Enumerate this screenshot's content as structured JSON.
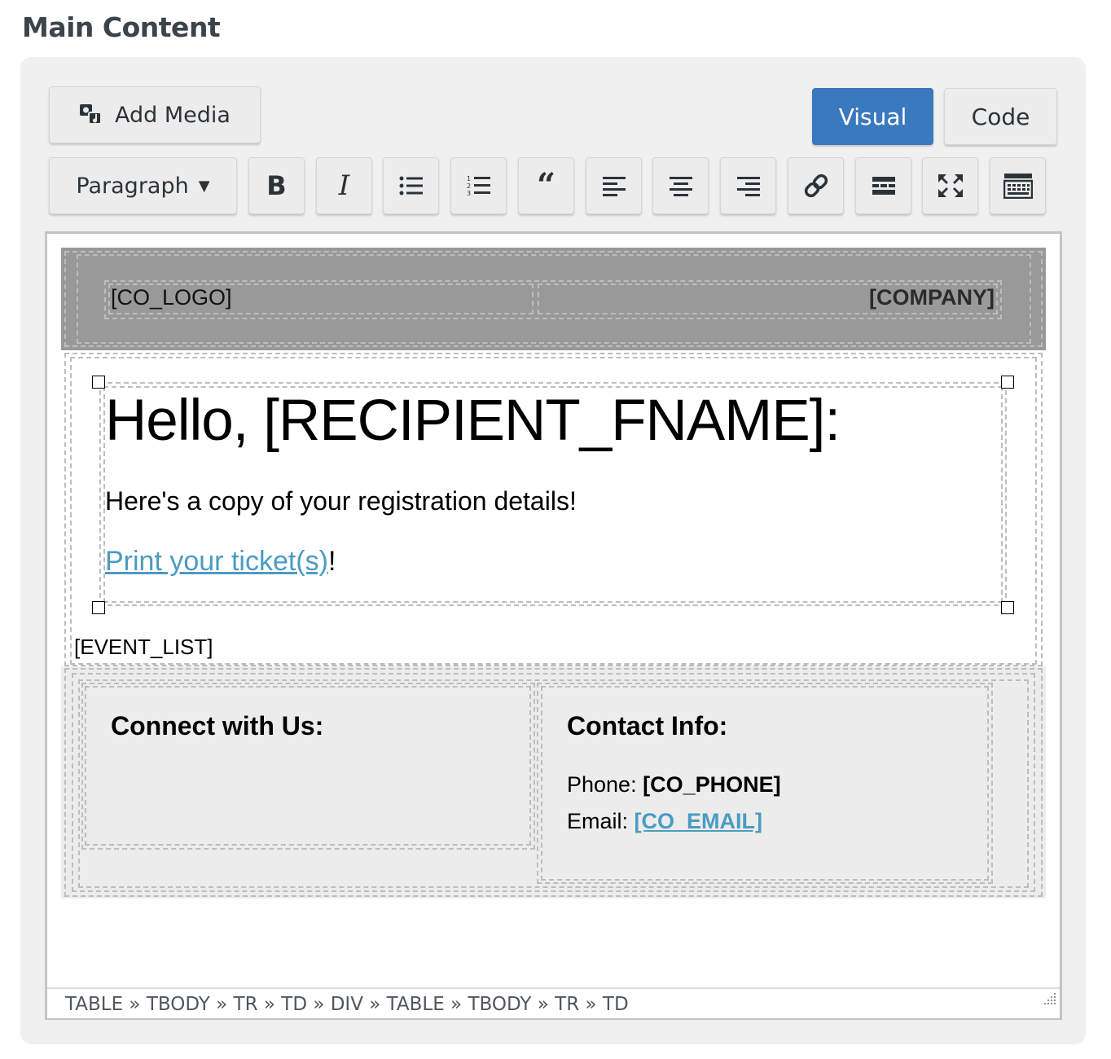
{
  "section_title": "Main Content",
  "toolbar": {
    "add_media_label": "Add Media",
    "visual_label": "Visual",
    "code_label": "Code",
    "format_select_value": "Paragraph",
    "bold_label": "B",
    "italic_label": "I",
    "buttons": [
      "bold-icon",
      "italic-icon",
      "bulleted-list-icon",
      "numbered-list-icon",
      "blockquote-icon",
      "align-left-icon",
      "align-center-icon",
      "align-right-icon",
      "link-icon",
      "read-more-icon",
      "fullscreen-icon",
      "toolbar-toggle-icon"
    ],
    "visual_color": "#3b79bf"
  },
  "content": {
    "co_logo": "[CO_LOGO]",
    "company": "[COMPANY]",
    "greeting": "Hello, [RECIPIENT_FNAME]:",
    "copy_text": "Here's a copy of your registration details!",
    "print_link": "Print your ticket(s)",
    "print_suffix": "!",
    "event_list": "[EVENT_LIST]",
    "connect_heading": "Connect with Us:",
    "contact_heading": "Contact Info:",
    "phone_label": "Phone: ",
    "phone_value": "[CO_PHONE]",
    "email_label": "Email: ",
    "email_value": "[CO_EMAIL]",
    "link_color": "#4b9bc1",
    "header_color": "#999999"
  },
  "status_path": "TABLE » TBODY » TR » TD » DIV » TABLE » TBODY » TR » TD"
}
